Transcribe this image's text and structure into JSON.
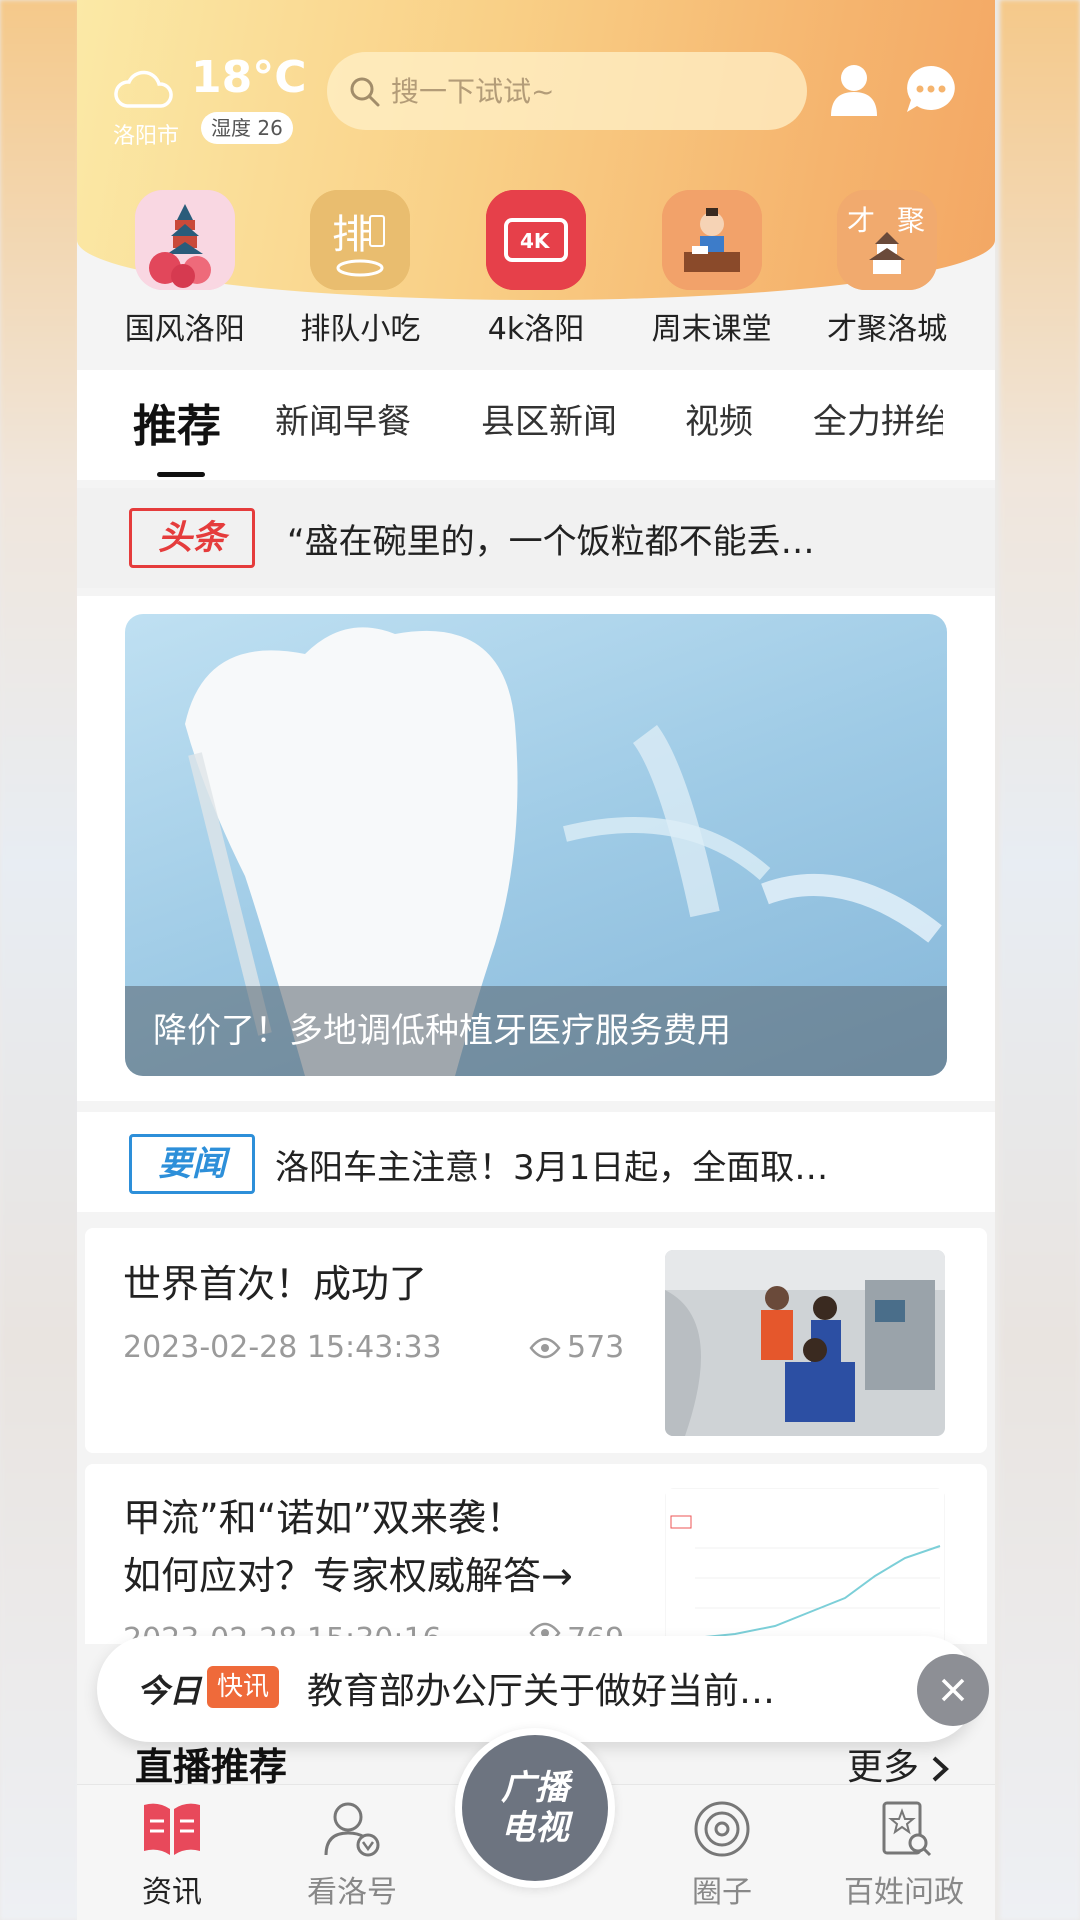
{
  "weather": {
    "temperature": "18°C",
    "city": "洛阳市",
    "humidity": "湿度 26",
    "icon": "cloud-icon"
  },
  "search": {
    "placeholder": "搜一下试试~"
  },
  "shortcuts": [
    {
      "label": "国风洛阳",
      "icon": "pagoda-peony-icon"
    },
    {
      "label": "排队小吃",
      "icon": "snack-icon"
    },
    {
      "label": "4k洛阳",
      "icon": "4k-icon"
    },
    {
      "label": "周末课堂",
      "icon": "classroom-icon"
    },
    {
      "label": "才聚洛城",
      "icon": "talent-pagoda-icon"
    }
  ],
  "tabs": [
    {
      "label": "推荐",
      "active": true
    },
    {
      "label": "新闻早餐"
    },
    {
      "label": "县区新闻"
    },
    {
      "label": "视频"
    },
    {
      "label": "全力拼绐"
    }
  ],
  "headline": {
    "tag": "头条",
    "text": "“盛在碗里的，一个饭粒都不能丢…"
  },
  "feature": {
    "caption": "降价了！多地调低种植牙医疗服务费用"
  },
  "yaowen": {
    "tag": "要闻",
    "text": "洛阳车主注意！3月1日起，全面取…"
  },
  "news": [
    {
      "title": "世界首次！成功了",
      "time": "2023-02-28 15:43:33",
      "views": "573"
    },
    {
      "title_line1": "甲流”和“诺如”双来袭！",
      "title_line2": "如何应对？专家权威解答→",
      "time": "2023-02-28 15:30:16",
      "views": "769"
    }
  ],
  "flash": {
    "logo": "今日",
    "badge": "快讯",
    "text": "教育部办公厅关于做好当前疫情…"
  },
  "live": {
    "title": "直播推荐",
    "more": "更多"
  },
  "center_button": {
    "line1": "广播",
    "line2": "电视"
  },
  "bottom_nav": [
    {
      "label": "资讯",
      "icon": "news-book-icon",
      "active": true
    },
    {
      "label": "看洛号",
      "icon": "person-badge-icon"
    },
    {
      "label": "圈子",
      "icon": "circle-spiral-icon"
    },
    {
      "label": "百姓问政",
      "icon": "document-search-icon"
    }
  ],
  "colors": {
    "header_start": "#fbe9a6",
    "header_end": "#f3a764",
    "tag_red": "#e53c3c",
    "tag_blue": "#2d8fd9",
    "nav_active": "#e8495b"
  }
}
